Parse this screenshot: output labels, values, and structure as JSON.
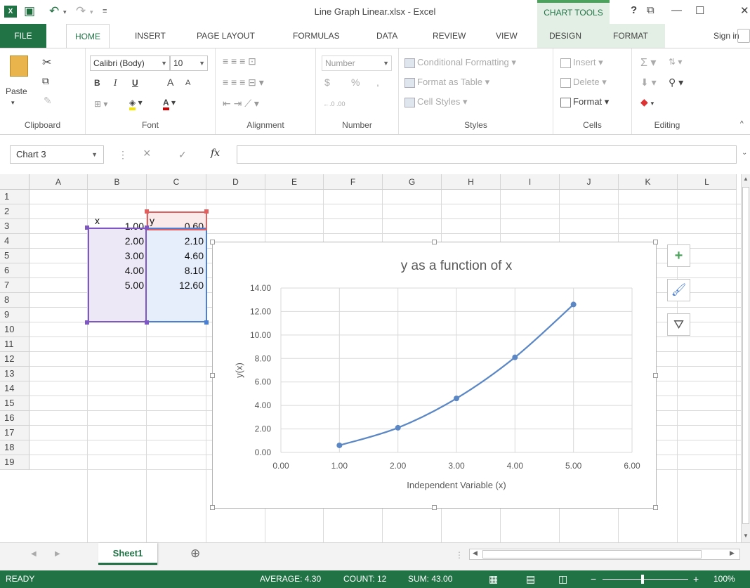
{
  "titlebar": {
    "document_title": "Line Graph Linear.xlsx - Excel",
    "contextual_group": "CHART TOOLS",
    "help": "?",
    "restore": "⧉",
    "minimize": "—",
    "maximize": "☐",
    "close": "✕"
  },
  "tabs": {
    "file": "FILE",
    "items": [
      "HOME",
      "INSERT",
      "PAGE LAYOUT",
      "FORMULAS",
      "DATA",
      "REVIEW",
      "VIEW",
      "DESIGN",
      "FORMAT"
    ],
    "sign_in": "Sign in"
  },
  "ribbon": {
    "clipboard": {
      "paste": "Paste",
      "label": "Clipboard"
    },
    "font": {
      "name": "Calibri (Body)",
      "size": "10",
      "bold": "B",
      "italic": "I",
      "underline": "U",
      "grow": "A",
      "shrink": "A",
      "label": "Font"
    },
    "alignment": {
      "label": "Alignment"
    },
    "number": {
      "format": "Number",
      "currency": "$",
      "percent": "%",
      "comma": ",",
      "inc_dec": "←.0 .00",
      "dec_dec": ".00 →.0",
      "label": "Number"
    },
    "styles": {
      "conditional": "Conditional Formatting",
      "format_table": "Format as Table",
      "cell_styles": "Cell Styles",
      "label": "Styles"
    },
    "cells": {
      "insert": "Insert",
      "delete": "Delete",
      "format": "Format",
      "label": "Cells"
    },
    "editing": {
      "label": "Editing"
    }
  },
  "formula_bar": {
    "name_box": "Chart 3",
    "cancel": "×",
    "enter": "✓",
    "fx": "fx",
    "value": ""
  },
  "grid": {
    "columns": [
      "A",
      "B",
      "C",
      "D",
      "E",
      "F",
      "G",
      "H",
      "I",
      "J",
      "K",
      "L"
    ],
    "rows": [
      "1",
      "2",
      "3",
      "4",
      "5",
      "6",
      "7",
      "8",
      "9",
      "10",
      "11",
      "12",
      "13",
      "14",
      "15",
      "16",
      "17",
      "18",
      "19"
    ],
    "header_x": "x",
    "header_y": "y",
    "x_values": [
      "1.00",
      "2.00",
      "3.00",
      "4.00",
      "5.00"
    ],
    "y_values": [
      "0.60",
      "2.10",
      "4.60",
      "8.10",
      "12.60"
    ]
  },
  "chart_side_buttons": {
    "elements": "+",
    "styles": "🖌",
    "filters": "⛛"
  },
  "chart_data": {
    "type": "scatter",
    "title": "y as a function of x",
    "xlabel": "Independent Variable (x)",
    "ylabel": "y(x)",
    "x": [
      1,
      2,
      3,
      4,
      5
    ],
    "series": [
      {
        "values": [
          0.6,
          2.1,
          4.6,
          8.1,
          12.6
        ]
      }
    ],
    "xlim": [
      0,
      6
    ],
    "ylim": [
      0,
      14
    ],
    "x_ticks": [
      "0.00",
      "1.00",
      "2.00",
      "3.00",
      "4.00",
      "5.00",
      "6.00"
    ],
    "y_ticks": [
      "0.00",
      "2.00",
      "4.00",
      "6.00",
      "8.00",
      "10.00",
      "12.00",
      "14.00"
    ],
    "grid": true,
    "line_color": "#5b87c5",
    "smoothed": true
  },
  "sheets": {
    "active": "Sheet1",
    "add": "⊕"
  },
  "status": {
    "mode": "READY",
    "average": "AVERAGE: 4.30",
    "count": "COUNT: 12",
    "sum": "SUM: 43.00",
    "zoom": "100%"
  },
  "colors": {
    "excel_green": "#217346",
    "selection_purple": "#7e57c2",
    "selection_blue": "#4a7fd4",
    "selection_red": "#e06060"
  }
}
